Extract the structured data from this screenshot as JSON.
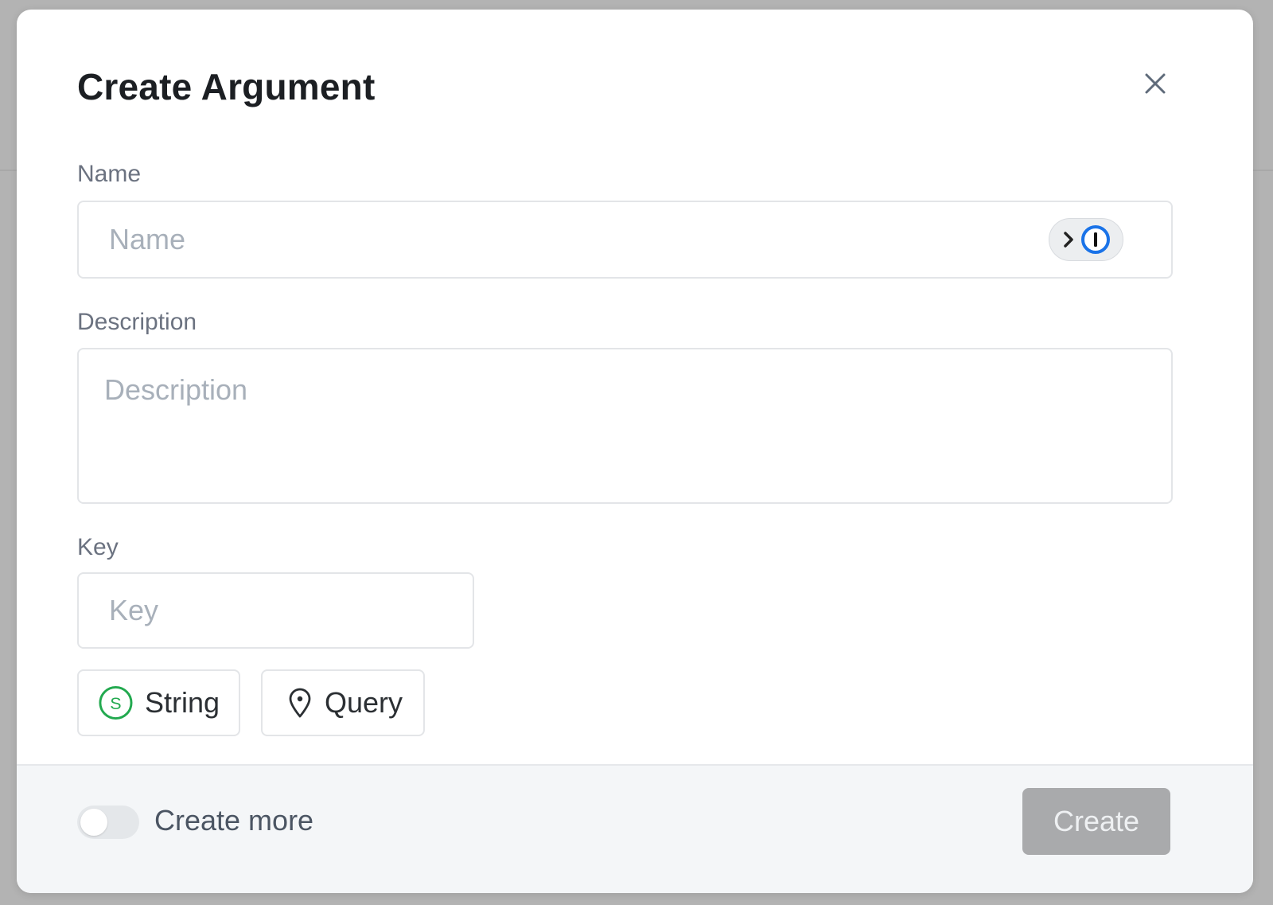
{
  "modal": {
    "title": "Create Argument",
    "close_icon": "close-icon"
  },
  "fields": {
    "name": {
      "label": "Name",
      "placeholder": "Name",
      "value": ""
    },
    "description": {
      "label": "Description",
      "placeholder": "Description",
      "value": ""
    },
    "key": {
      "label": "Key",
      "placeholder": "Key",
      "value": ""
    }
  },
  "password_manager": {
    "icon": "password-manager-icon",
    "accent": "#1a73e8"
  },
  "chips": {
    "type": {
      "label": "String",
      "icon": "string-type-icon",
      "color": "#22a94f"
    },
    "location": {
      "label": "Query",
      "icon": "location-pin-icon"
    }
  },
  "footer": {
    "create_more_label": "Create more",
    "create_more_enabled": false,
    "create_label": "Create"
  }
}
